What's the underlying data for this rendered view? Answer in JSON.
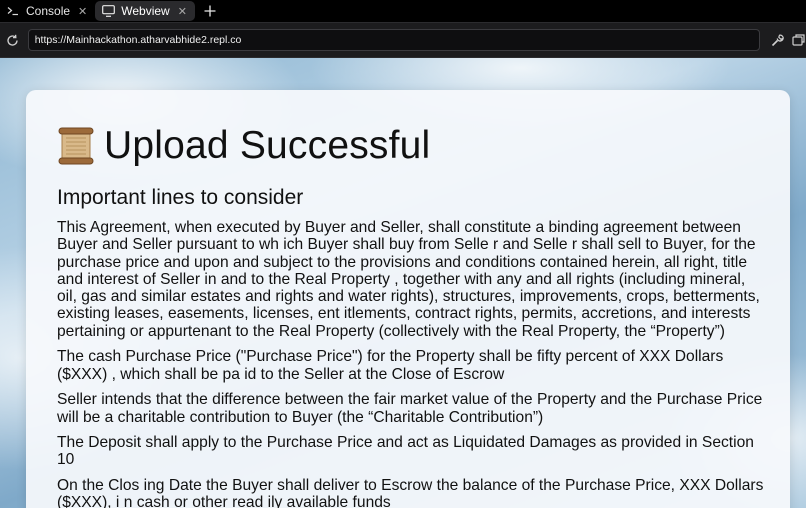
{
  "tabs": [
    {
      "label": "Console",
      "active": false,
      "icon": "terminal-icon"
    },
    {
      "label": "Webview",
      "active": true,
      "icon": "monitor-icon"
    }
  ],
  "address_bar": {
    "url": "https://Mainhackathon.atharvabhide2.repl.co"
  },
  "page": {
    "title": "Upload Successful",
    "title_icon": "scroll-icon",
    "section_heading": "Important lines to consider",
    "lines": [
      "This Agreement, when executed by Buyer and Seller, shall constitute a binding agreement between Buyer and Seller pursuant to wh ich Buyer shall buy from Selle r and Selle r shall sell to Buyer, for the purchase price and upon and subject to the provisions and conditions contained herein, all right, title and interest of Seller in and to the Real Property , together with any and all rights (including mineral, oil, gas and similar estates and rights and water rights), structures, improvements, crops, betterments, existing leases, easements, licenses, ent itlements, contract rights, permits, accretions, and interests pertaining or appurtenant to the Real Property (collectively with the Real Property, the “Property”)",
      "The cash Purchase Price (\"Purchase Price\") for the Property shall be fifty percent of XXX Dollars ($XXX) , which shall be pa id to the Seller at the Close of Escrow",
      "Seller intends that the difference between the fair market value of the Property and the Purchase Price will be a charitable contribution to Buyer (the “Charitable Contribution”)",
      "The Deposit shall apply to the Purchase Price and act as Liquidated Damages as provided in Section 10",
      "On the Clos ing Date the Buyer shall deliver to Escrow the balance of the Purchase Price, XXX Dollars ($XXX), i n cash or other read ily available funds"
    ]
  },
  "colors": {
    "tabbar_bg": "#000000",
    "active_tab_bg": "#2a2a2d",
    "urlbar_bg": "#1c1c1e",
    "card_bg": "#f6f9fc",
    "text": "#111111"
  }
}
